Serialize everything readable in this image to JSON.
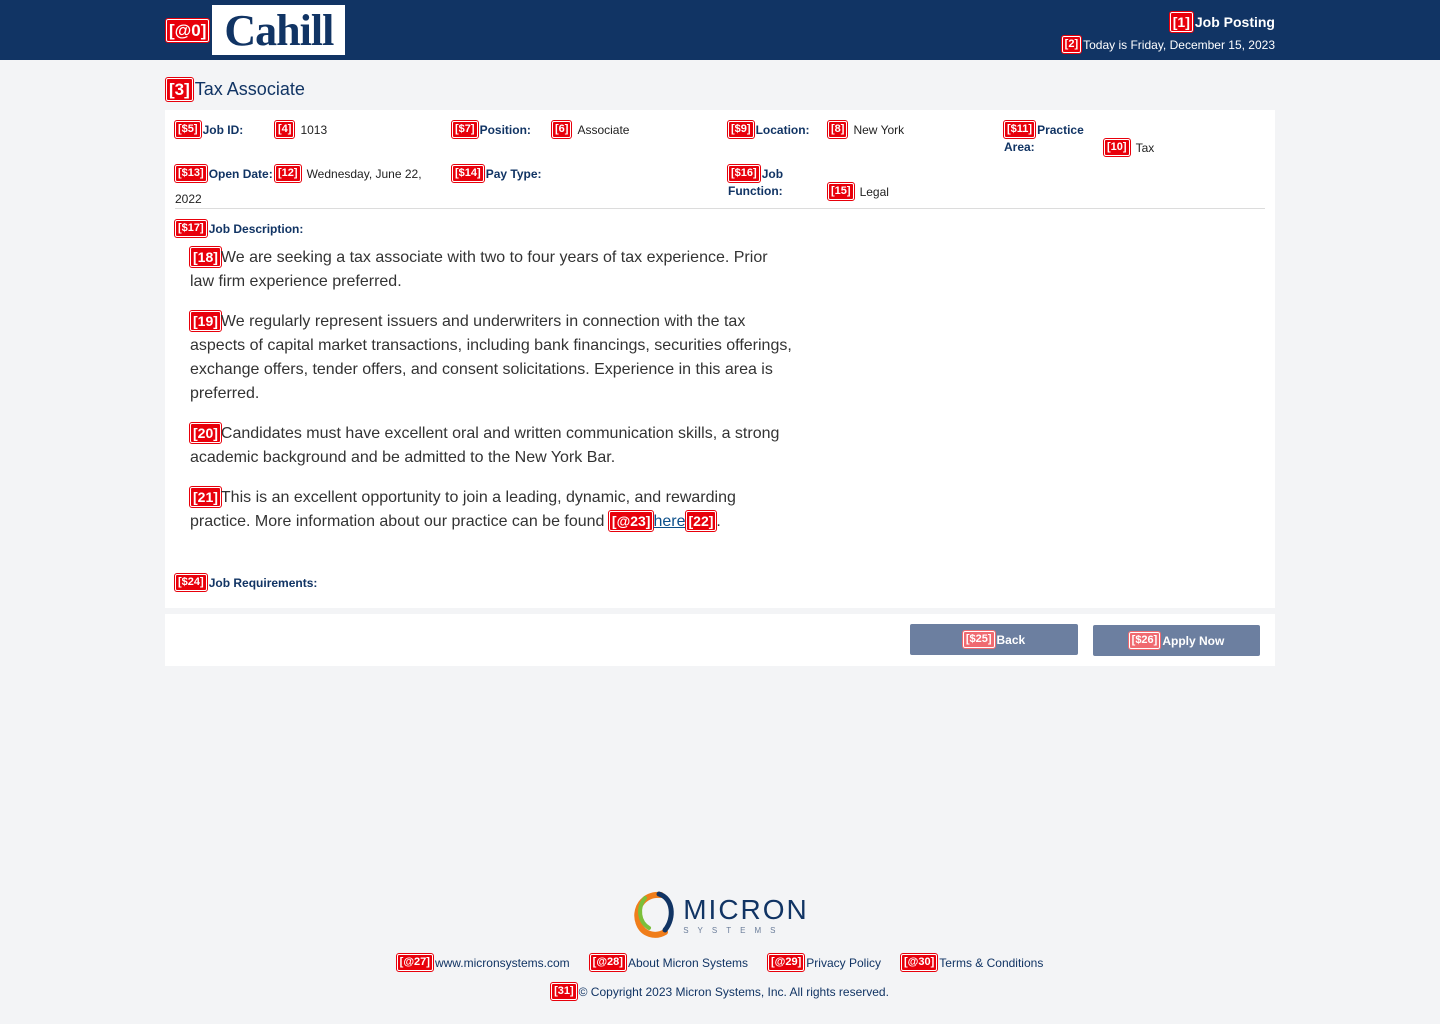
{
  "marks": {
    "m0": "[@0]",
    "m1": "[1]",
    "m2": "[2]",
    "m3": "[3]",
    "m4": "[4]",
    "m5": "[$5]",
    "m6": "[6]",
    "m7": "[$7]",
    "m8": "[8]",
    "m9": "[$9]",
    "m10": "[10]",
    "m11": "[$11]",
    "m12": "[12]",
    "m13": "[$13]",
    "m14": "[$14]",
    "m15": "[15]",
    "m16": "[$16]",
    "m17": "[$17]",
    "m18": "[18]",
    "m19": "[19]",
    "m20": "[20]",
    "m21": "[21]",
    "m22": "[22]",
    "m23": "[@23]",
    "m24": "[$24]",
    "m25": "[$25]",
    "m26": "[$26]",
    "m27": "[@27]",
    "m28": "[@28]",
    "m29": "[@29]",
    "m30": "[@30]",
    "m31": "[31]"
  },
  "header": {
    "logo_text": "Cahill",
    "title": "Job Posting",
    "date": "Today is Friday, December 15, 2023"
  },
  "job": {
    "title": "Tax Associate",
    "fields": {
      "job_id_label": "Job ID:",
      "job_id": "1013",
      "position_label": "Position:",
      "position": "Associate",
      "location_label": "Location:",
      "location": "New York",
      "practice_label_1": "Practice",
      "practice_label_2": "Area:",
      "practice": "Tax",
      "open_date_label": "Open Date:",
      "open_date_1": "Wednesday, June 22,",
      "open_date_2": "2022",
      "pay_type_label": "Pay Type:",
      "function_label_1": "Job",
      "function_label_2": "Function:",
      "function": "Legal"
    },
    "description_label": "Job Description:",
    "paragraphs": [
      "We are seeking a tax associate with two to four years of tax experience. Prior law firm experience preferred.",
      "We regularly represent issuers and underwriters in connection with the tax aspects of capital market transactions, including bank financings, securities offerings, exchange offers, tender offers, and consent solicitations. Experience in this area is preferred.",
      "Candidates must have excellent oral and written communication skills, a strong academic background and be admitted to the New York Bar.",
      "This is an excellent opportunity to join a leading, dynamic, and rewarding practice. More information about our practice can be found "
    ],
    "link_text": "here",
    "period": ".",
    "requirements_label": "Job Requirements:"
  },
  "actions": {
    "back": "Back",
    "apply": "Apply Now"
  },
  "footer": {
    "brand": "MICRON",
    "brand_sub": "SYSTEMS",
    "links": [
      "www.micronsystems.com",
      "About Micron Systems",
      "Privacy Policy",
      "Terms & Conditions"
    ],
    "copyright": "© Copyright 2023 Micron Systems, Inc. All rights reserved."
  },
  "colors": {
    "header_bg": "#113464",
    "button_bg": "#6c7fa0",
    "tag_red": "#e8000b"
  }
}
